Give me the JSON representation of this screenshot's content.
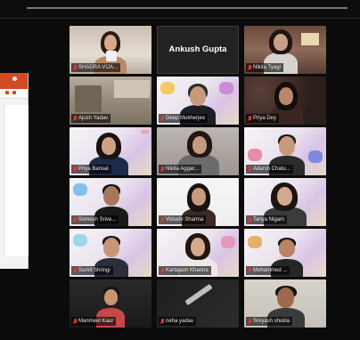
{
  "meeting": {
    "participants": [
      {
        "name": "SHADRA VIJA..."
      },
      {
        "name": "Ankush Gupta"
      },
      {
        "name": "Nikita Tyagi"
      },
      {
        "name": "Ajush Yadav"
      },
      {
        "name": "Deep Mukherjee"
      },
      {
        "name": "Priya Dey"
      },
      {
        "name": "Priya Bansal"
      },
      {
        "name": "Nikita Aggar..."
      },
      {
        "name": "Adarsh Chatu..."
      },
      {
        "name": "Somesh Srive..."
      },
      {
        "name": "Vidushi Sharma"
      },
      {
        "name": "Tanya Nigam"
      },
      {
        "name": "Sumit Shringi"
      },
      {
        "name": "Kartajash Khanna"
      },
      {
        "name": "Mohammed ..."
      },
      {
        "name": "Manmeet Kaur"
      },
      {
        "name": "neha yadav"
      },
      {
        "name": "Sreyash shukla"
      }
    ]
  },
  "colors": {
    "background": "#0b0b0b",
    "muted_mic": "#e33333",
    "app_accent": "#d04a22"
  },
  "icons": {
    "tile_status": "muted-mic-icon"
  }
}
